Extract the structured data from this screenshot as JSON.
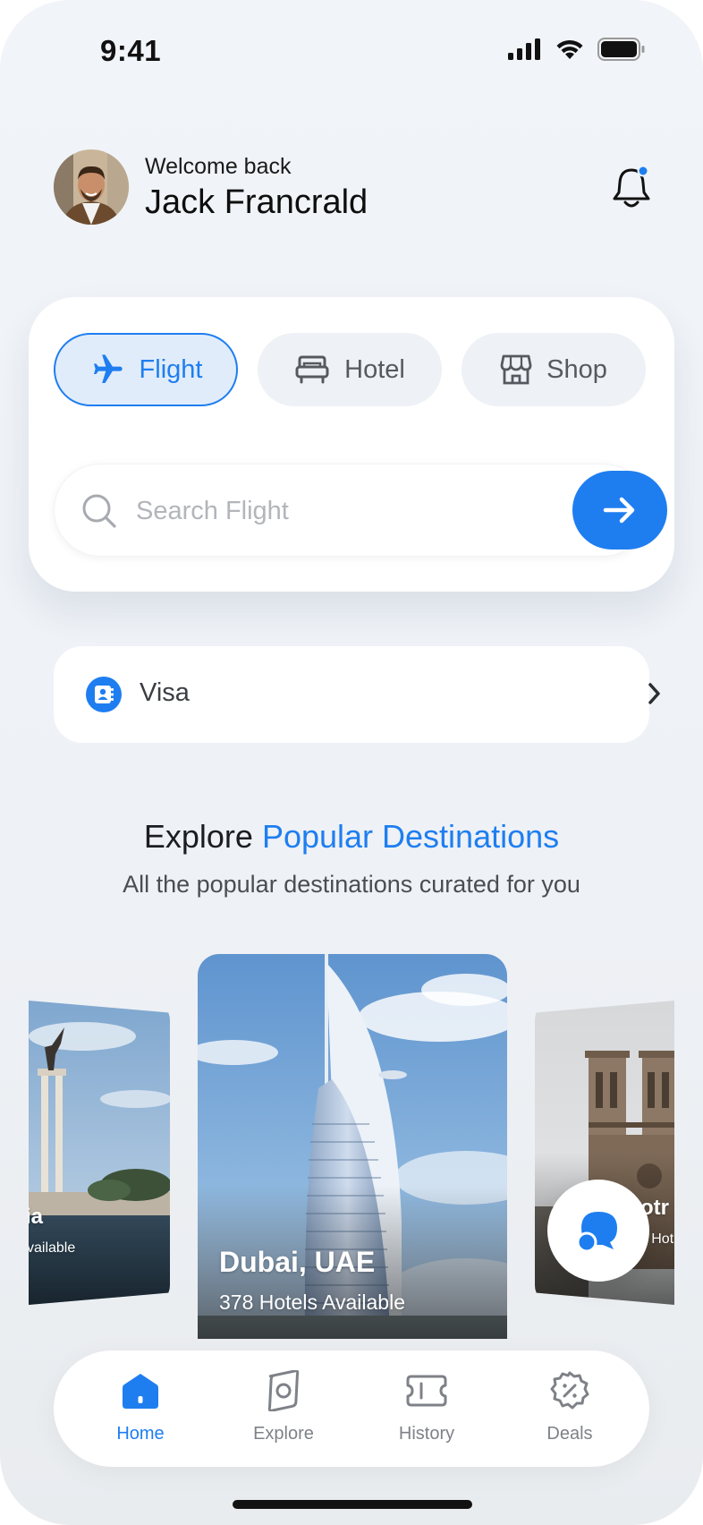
{
  "status_bar": {
    "time": "9:41"
  },
  "header": {
    "welcome": "Welcome back",
    "user_name": "Jack Francrald"
  },
  "search_card": {
    "tabs": [
      {
        "label": "Flight",
        "icon": "airplane-icon",
        "active": true
      },
      {
        "label": "Hotel",
        "icon": "bed-icon",
        "active": false
      },
      {
        "label": "Shop",
        "icon": "storefront-icon",
        "active": false
      }
    ],
    "search_placeholder": "Search Flight"
  },
  "visa": {
    "label": "Visa",
    "icon": "contact-card-icon"
  },
  "section": {
    "title_prefix": "Explore",
    "title_accent": "Popular Destinations",
    "subtitle": "All the popular destinations curated for you"
  },
  "destinations": {
    "left": {
      "name": "ia",
      "sub": "vailable"
    },
    "main": {
      "name": "Dubai, UAE",
      "sub": "378 Hotels Available"
    },
    "right": {
      "name": "otr",
      "sub": "94 Hot"
    }
  },
  "bottom_nav": {
    "items": [
      {
        "label": "Home",
        "icon": "home-icon",
        "active": true
      },
      {
        "label": "Explore",
        "icon": "compass-icon",
        "active": false
      },
      {
        "label": "History",
        "icon": "ticket-icon",
        "active": false
      },
      {
        "label": "Deals",
        "icon": "discount-badge-icon",
        "active": false
      }
    ]
  },
  "colors": {
    "accent": "#1e7ef0",
    "background": "#f1f4f8",
    "card": "#ffffff",
    "text_primary": "#111111",
    "text_muted": "#7e8187"
  }
}
